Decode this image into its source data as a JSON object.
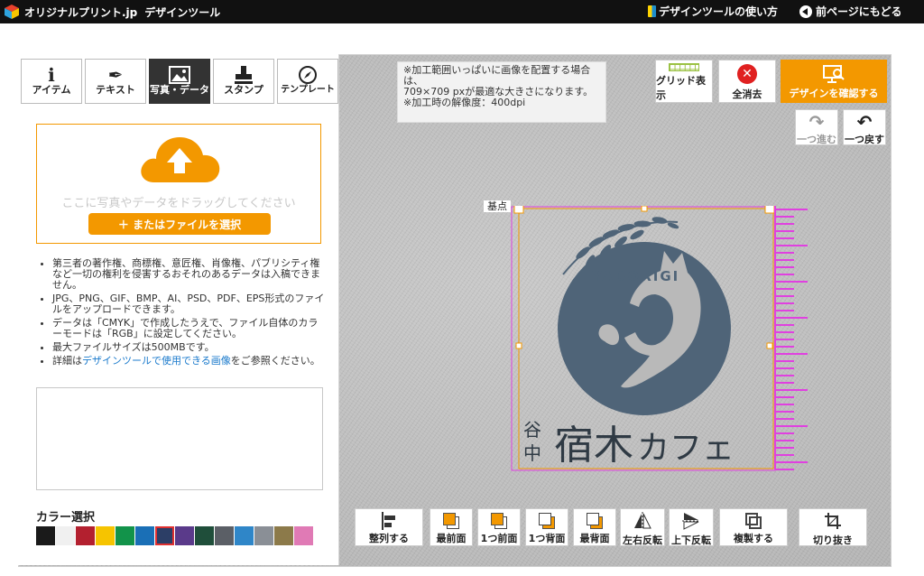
{
  "header": {
    "brand": "オリジナルプリント.jp",
    "title": "デザインツール",
    "howto_label": "デザインツールの使い方",
    "back_label": "前ページにもどる"
  },
  "tabs": [
    {
      "label": "アイテム",
      "icon": "info-icon"
    },
    {
      "label": "テキスト",
      "icon": "pen-icon"
    },
    {
      "label": "写真・データ",
      "icon": "image-icon"
    },
    {
      "label": "スタンプ",
      "icon": "stamp-icon"
    },
    {
      "label": "テンプレート",
      "icon": "compass-icon"
    }
  ],
  "upload": {
    "drop_text": "ここに写真やデータをドラッグしてください",
    "file_button": "＋ またはファイルを選択"
  },
  "notes": [
    {
      "text": "第三者の著作権、商標権、意匠権、肖像権、パブリシティ権など一切の権利を侵害するおそれのあるデータは入稿できません。"
    },
    {
      "text": "JPG、PNG、GIF、BMP、AI、PSD、PDF、EPS形式のファイルをアップロードできます。"
    },
    {
      "text": "データは「CMYK」で作成したうえで、ファイル自体のカラーモードは「RGB」に設定してください。"
    },
    {
      "text": "最大ファイルサイズは500MBです。"
    }
  ],
  "note_link": {
    "before": "詳細は",
    "link": "デザインツールで使用できる画像",
    "after": "をご参照ください。"
  },
  "color_section": {
    "title": "カラー選択",
    "swatches": [
      "#1a1a1a",
      "#f0f0f0",
      "#b3202f",
      "#f6c400",
      "#12934a",
      "#1a6fb6",
      "#2c3e66",
      "#5a3a8a",
      "#1f4e3a",
      "#5b5f66",
      "#2f86c8",
      "#8a8f96",
      "#8c7a4a",
      "#e07ab5"
    ],
    "selected_index": 6
  },
  "info": {
    "line1": "※加工範囲いっぱいに画像を配置する場合は、",
    "line2": "709×709 pxが最適な大きさになります。",
    "line3": "※加工時の解像度：400dpi"
  },
  "tools": {
    "grid": "グリッド表示",
    "clear": "全消去",
    "confirm": "デザインを確認する",
    "redo": "一つ進む",
    "undo": "一つ戻す"
  },
  "stage": {
    "base_label": "基点",
    "logo_text": "YADORIGI",
    "cafe_small": "谷中",
    "cafe_name": "宿木カフェ",
    "logo_color": "#4f6478",
    "accent": "#f39800",
    "guide_color": "#e040e0"
  },
  "bottom_tools": [
    {
      "label": "整列する",
      "icon": "align-icon"
    },
    {
      "label": "最前面",
      "icon": "bring-front-icon"
    },
    {
      "label": "1つ前面",
      "icon": "forward-icon"
    },
    {
      "label": "1つ背面",
      "icon": "backward-icon"
    },
    {
      "label": "最背面",
      "icon": "send-back-icon"
    },
    {
      "label": "左右反転",
      "icon": "flip-horizontal-icon"
    },
    {
      "label": "上下反転",
      "icon": "flip-vertical-icon"
    },
    {
      "label": "複製する",
      "icon": "duplicate-icon"
    },
    {
      "label": "切り抜き",
      "icon": "crop-icon"
    }
  ]
}
